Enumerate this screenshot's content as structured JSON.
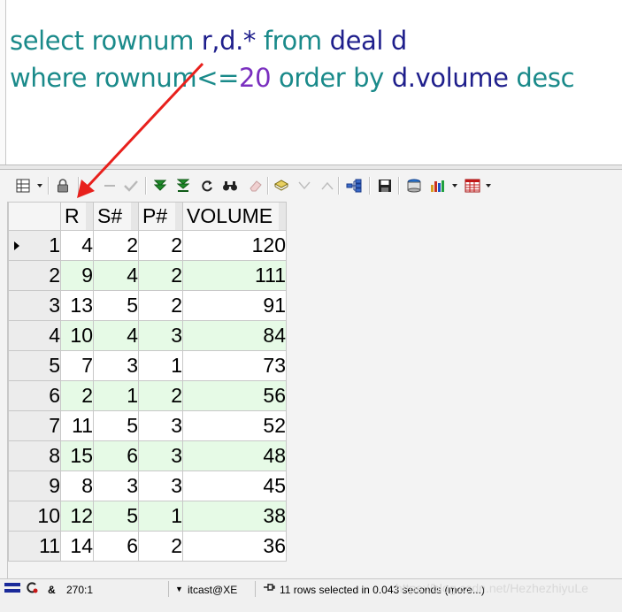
{
  "editor": {
    "line1": {
      "kw1": "select rownum ",
      "id1": "r,d.*",
      "kw2": " from ",
      "id2": "deal d"
    },
    "line2": {
      "kw1": "where rownum<=",
      "num": "20",
      "kw2": " order by ",
      "id1": "d.volume",
      "kw3": " desc"
    }
  },
  "toolbar": {
    "icons": [
      "grid-options-icon",
      "lock-icon",
      "delete-record-icon",
      "post-record-icon",
      "fetch-next-icon",
      "fetch-last-icon",
      "refresh-icon",
      "find-icon",
      "clear-icon",
      "query-by-example-icon",
      "filter-down-icon",
      "filter-up-icon",
      "link-icon",
      "save-icon",
      "export-icon",
      "chart-icon",
      "table-icon"
    ]
  },
  "grid": {
    "columns": [
      "R",
      "S#",
      "P#",
      "VOLUME"
    ],
    "rows": [
      {
        "n": "1",
        "r": "4",
        "s": "2",
        "p": "2",
        "v": "120"
      },
      {
        "n": "2",
        "r": "9",
        "s": "4",
        "p": "2",
        "v": "111"
      },
      {
        "n": "3",
        "r": "13",
        "s": "5",
        "p": "2",
        "v": "91"
      },
      {
        "n": "4",
        "r": "10",
        "s": "4",
        "p": "3",
        "v": "84"
      },
      {
        "n": "5",
        "r": "7",
        "s": "3",
        "p": "1",
        "v": "73"
      },
      {
        "n": "6",
        "r": "2",
        "s": "1",
        "p": "2",
        "v": "56"
      },
      {
        "n": "7",
        "r": "11",
        "s": "5",
        "p": "3",
        "v": "52"
      },
      {
        "n": "8",
        "r": "15",
        "s": "6",
        "p": "3",
        "v": "48"
      },
      {
        "n": "9",
        "r": "8",
        "s": "3",
        "p": "3",
        "v": "45"
      },
      {
        "n": "10",
        "r": "12",
        "s": "5",
        "p": "1",
        "v": "38"
      },
      {
        "n": "11",
        "r": "14",
        "s": "6",
        "p": "2",
        "v": "36"
      }
    ]
  },
  "status": {
    "ampersand": "&",
    "position": "270:1",
    "connection": "itcast@XE",
    "message": "11 rows selected in 0.043 seconds (more...)",
    "watermark": "https://blog.csdn.net/HezhezhiyuLe"
  },
  "colors": {
    "keyword": "#1a8a8a",
    "identifier": "#1f1f8c",
    "number": "#7a2fbf",
    "alt_row": "#e6fae6",
    "arrow": "#e8201c"
  }
}
